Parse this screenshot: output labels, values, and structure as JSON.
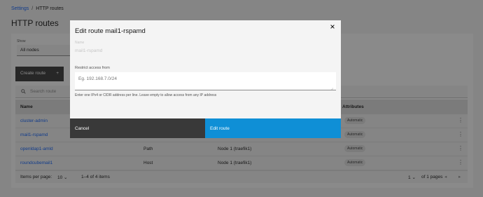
{
  "breadcrumb": {
    "root": "Settings",
    "separator": "/",
    "current": "HTTP routes"
  },
  "page_title": "HTTP routes",
  "filters": {
    "show_label": "Show",
    "selected_node": "All nodes"
  },
  "toolbar": {
    "create_label": "Create route",
    "create_icon": "+"
  },
  "search": {
    "placeholder": "Search route",
    "icon": "search-icon"
  },
  "table": {
    "headers": {
      "name": "Name",
      "attributes": "Attributes"
    },
    "rows": [
      {
        "name": "cluster-admin",
        "type": "",
        "node": "",
        "attribute": "Automatic"
      },
      {
        "name": "mail1-rspamd",
        "type": "",
        "node": "",
        "attribute": "Automatic"
      },
      {
        "name": "openldap1-amld",
        "type": "Path",
        "node": "Node 1 (traefik1)",
        "attribute": "Automatic"
      },
      {
        "name": "roundcubemail1",
        "type": "Host",
        "node": "Node 1 (traefik1)",
        "attribute": "Automatic"
      }
    ],
    "overflow_icon": "⋮"
  },
  "pagination": {
    "items_per_page_label": "Items per page:",
    "items_per_page_value": "10",
    "range_text": "1–4 of 4 items",
    "page_value": "1",
    "of_pages_text": "of 1 pages"
  },
  "modal": {
    "title": "Edit route mail1-rspamd",
    "name_label": "Name",
    "name_value": "mail1-rspamd",
    "restrict_label": "Restrict access from",
    "restrict_placeholder": "Eg. 192.168.7.0/24",
    "helper_text": "Enter one IPv4 or CIDR address per line. Leave empty to allow access from any IP address",
    "cancel_label": "Cancel",
    "primary_label": "Edit route"
  },
  "colors": {
    "link": "#0f62fe",
    "primary_button": "#0f8fd6",
    "secondary_button": "#393939"
  }
}
